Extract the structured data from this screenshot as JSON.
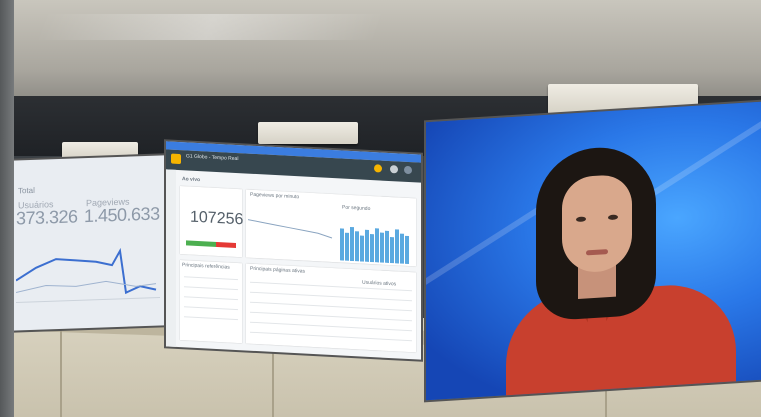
{
  "dashboard_left": {
    "title": "Total",
    "metrics": [
      {
        "label": "Usuários",
        "value": "373.326"
      },
      {
        "label": "Pageviews",
        "value": "1.450.633"
      }
    ]
  },
  "dashboard_center": {
    "header_title": "G1 Globo - Tempo Real",
    "active_users_label": "Ao vivo",
    "active_users": "107256",
    "chart_label_left": "Pageviews por minuto",
    "chart_label_right": "Por segundo",
    "table_left_title": "Principais referências",
    "table_right_title": "Principais páginas ativas",
    "column_header": "Usuários ativos"
  },
  "colors": {
    "accent_blue": "#3b7de0",
    "header_dark": "#37474f",
    "chart_blue": "#5aa9e0",
    "news_blue": "#1f5fd4",
    "shirt_red": "#c8402e"
  }
}
